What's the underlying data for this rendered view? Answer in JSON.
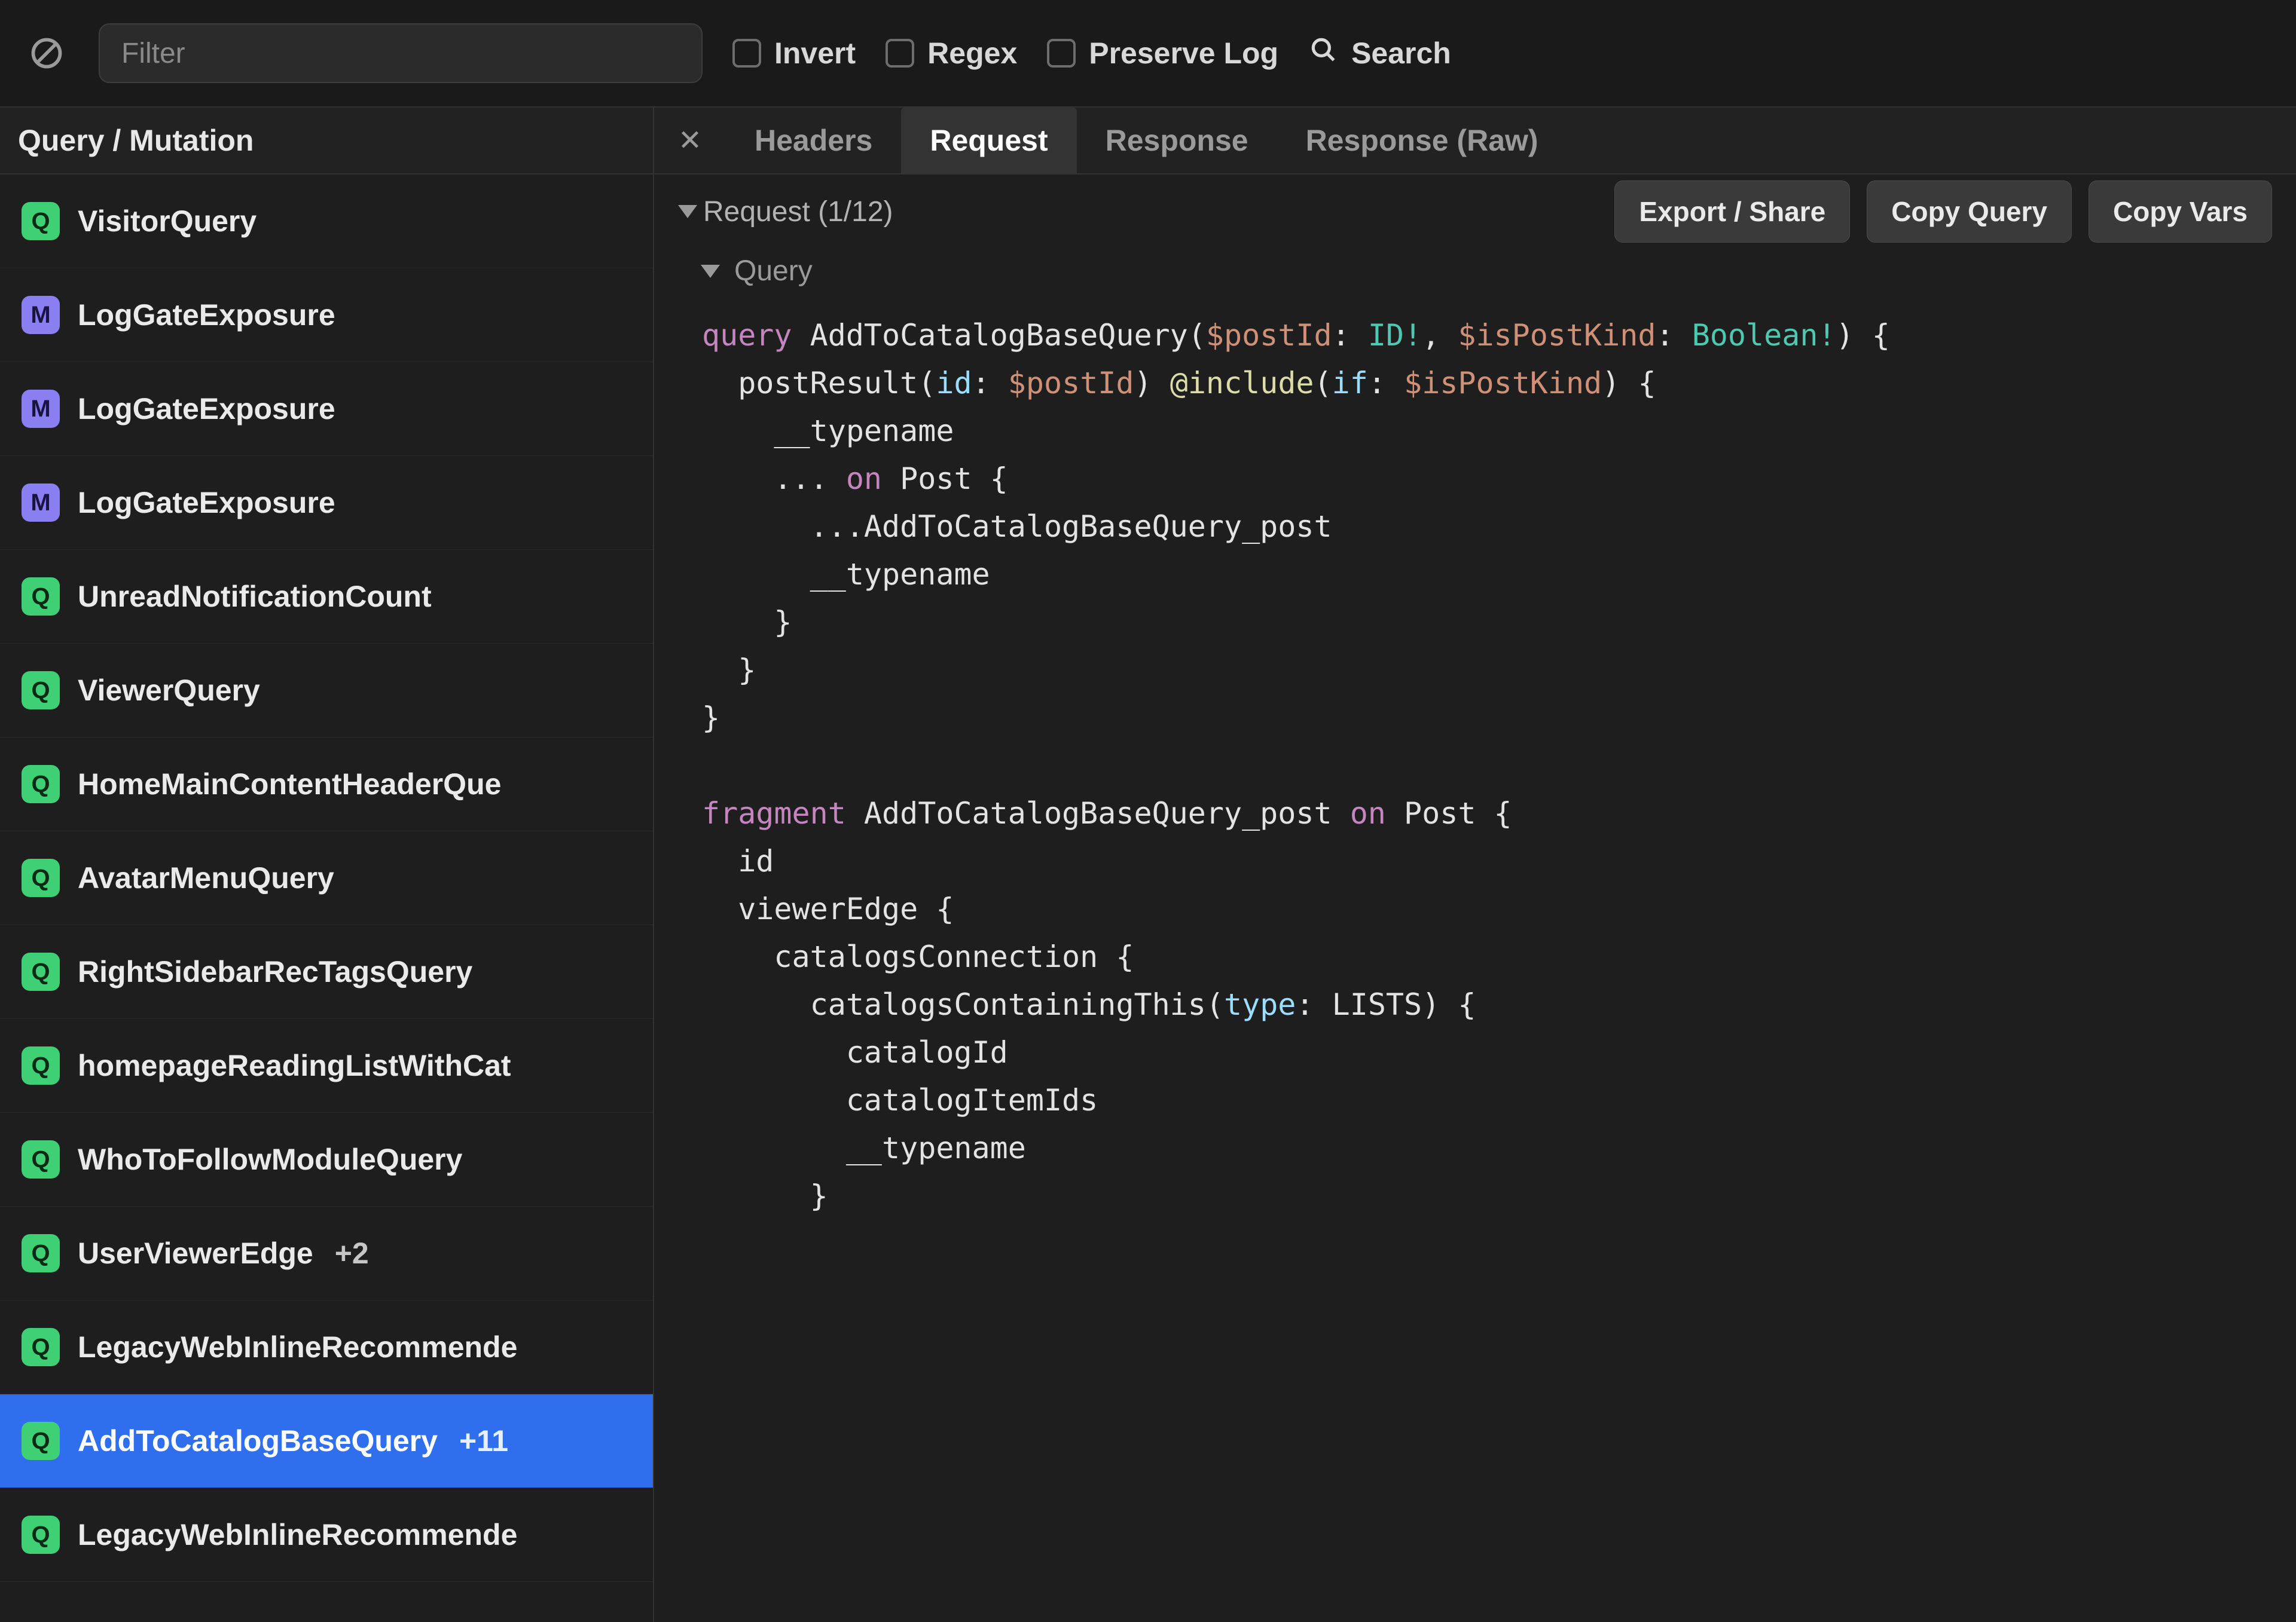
{
  "toolbar": {
    "filter_placeholder": "Filter",
    "invert_label": "Invert",
    "regex_label": "Regex",
    "preserve_label": "Preserve Log",
    "search_label": "Search"
  },
  "sidebar": {
    "header": "Query / Mutation",
    "items": [
      {
        "kind": "Q",
        "label": "VisitorQuery",
        "count": ""
      },
      {
        "kind": "M",
        "label": "LogGateExposure",
        "count": ""
      },
      {
        "kind": "M",
        "label": "LogGateExposure",
        "count": ""
      },
      {
        "kind": "M",
        "label": "LogGateExposure",
        "count": ""
      },
      {
        "kind": "Q",
        "label": "UnreadNotificationCount",
        "count": ""
      },
      {
        "kind": "Q",
        "label": "ViewerQuery",
        "count": ""
      },
      {
        "kind": "Q",
        "label": "HomeMainContentHeaderQue",
        "count": ""
      },
      {
        "kind": "Q",
        "label": "AvatarMenuQuery",
        "count": ""
      },
      {
        "kind": "Q",
        "label": "RightSidebarRecTagsQuery",
        "count": ""
      },
      {
        "kind": "Q",
        "label": "homepageReadingListWithCat",
        "count": ""
      },
      {
        "kind": "Q",
        "label": "WhoToFollowModuleQuery",
        "count": ""
      },
      {
        "kind": "Q",
        "label": "UserViewerEdge",
        "count": "+2"
      },
      {
        "kind": "Q",
        "label": "LegacyWebInlineRecommende",
        "count": ""
      },
      {
        "kind": "Q",
        "label": "AddToCatalogBaseQuery",
        "count": "+11",
        "selected": true
      },
      {
        "kind": "Q",
        "label": "LegacyWebInlineRecommende",
        "count": ""
      }
    ]
  },
  "tabs": {
    "headers": "Headers",
    "request": "Request",
    "response": "Response",
    "response_raw": "Response (Raw)"
  },
  "detail": {
    "request_title": "Request (1/12)",
    "query_label": "Query",
    "export_btn": "Export / Share",
    "copy_query_btn": "Copy Query",
    "copy_vars_btn": "Copy Vars"
  },
  "code": {
    "l1": {
      "kw": "query",
      "name": " AddToCatalogBaseQuery(",
      "var1": "$postId",
      "p1": ": ",
      "type1": "ID!",
      "p2": ", ",
      "var2": "$isPostKind",
      "p3": ": ",
      "type2": "Boolean!",
      "p4": ") {"
    },
    "l2": {
      "indent": "  ",
      "name": "postResult(",
      "arg": "id",
      "p1": ": ",
      "var": "$postId",
      "p2": ") ",
      "dir": "@include",
      "p3": "(",
      "arg2": "if",
      "p4": ": ",
      "var2": "$isPostKind",
      "p5": ") {"
    },
    "l3": "    __typename",
    "l4": {
      "indent": "    ... ",
      "kw": "on",
      "rest": " Post {"
    },
    "l5": "      ...AddToCatalogBaseQuery_post",
    "l6": "      __typename",
    "l7": "    }",
    "l8": "  }",
    "l9": "}",
    "blank": "",
    "f1": {
      "kw": "fragment",
      "name": " AddToCatalogBaseQuery_post ",
      "kw2": "on",
      "rest": " Post {"
    },
    "f2": "  id",
    "f3": "  viewerEdge {",
    "f4": "    catalogsConnection {",
    "f5": {
      "indent": "      catalogsContainingThis(",
      "arg": "type",
      "p1": ": LISTS) {"
    },
    "f6": "        catalogId",
    "f7": "        catalogItemIds",
    "f8": "        __typename",
    "f9": "      }"
  }
}
